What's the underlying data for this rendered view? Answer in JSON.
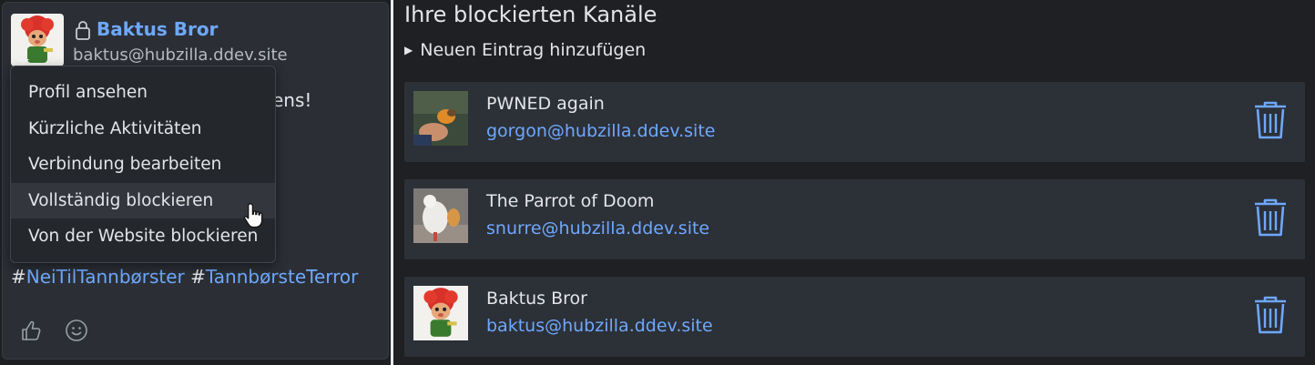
{
  "post": {
    "author_name": "Baktus Bror",
    "author_address": "baktus@hubzilla.ddev.site",
    "text_fragment": "ens!",
    "hashtags": [
      {
        "hash": "#",
        "tag": "NeiTilTannbørster"
      },
      {
        "hash": "#",
        "tag": "TannbørsteTerror"
      }
    ]
  },
  "menu": {
    "items": [
      {
        "label": "Profil ansehen"
      },
      {
        "label": "Kürzliche Aktivitäten"
      },
      {
        "label": "Verbindung bearbeiten"
      },
      {
        "label": "Vollständig blockieren"
      },
      {
        "label": "Von der Website blockieren"
      }
    ],
    "hovered_index": 3
  },
  "blocked": {
    "title": "Ihre blockierten Kanäle",
    "add_label": "Neuen Eintrag hinzufügen",
    "entries": [
      {
        "name": "PWNED again",
        "address": "gorgon@hubzilla.ddev.site",
        "avatar": "hand-with-bird-avatar"
      },
      {
        "name": "The Parrot of Doom",
        "address": "snurre@hubzilla.ddev.site",
        "avatar": "white-parrot-avatar"
      },
      {
        "name": "Baktus Bror",
        "address": "baktus@hubzilla.ddev.site",
        "avatar": "red-hair-troll-avatar"
      }
    ]
  },
  "colors": {
    "link": "#6ea8fe",
    "panel_bg": "#2b2f35",
    "entry_bg": "#2c3037",
    "page_bg": "#1e2024"
  }
}
